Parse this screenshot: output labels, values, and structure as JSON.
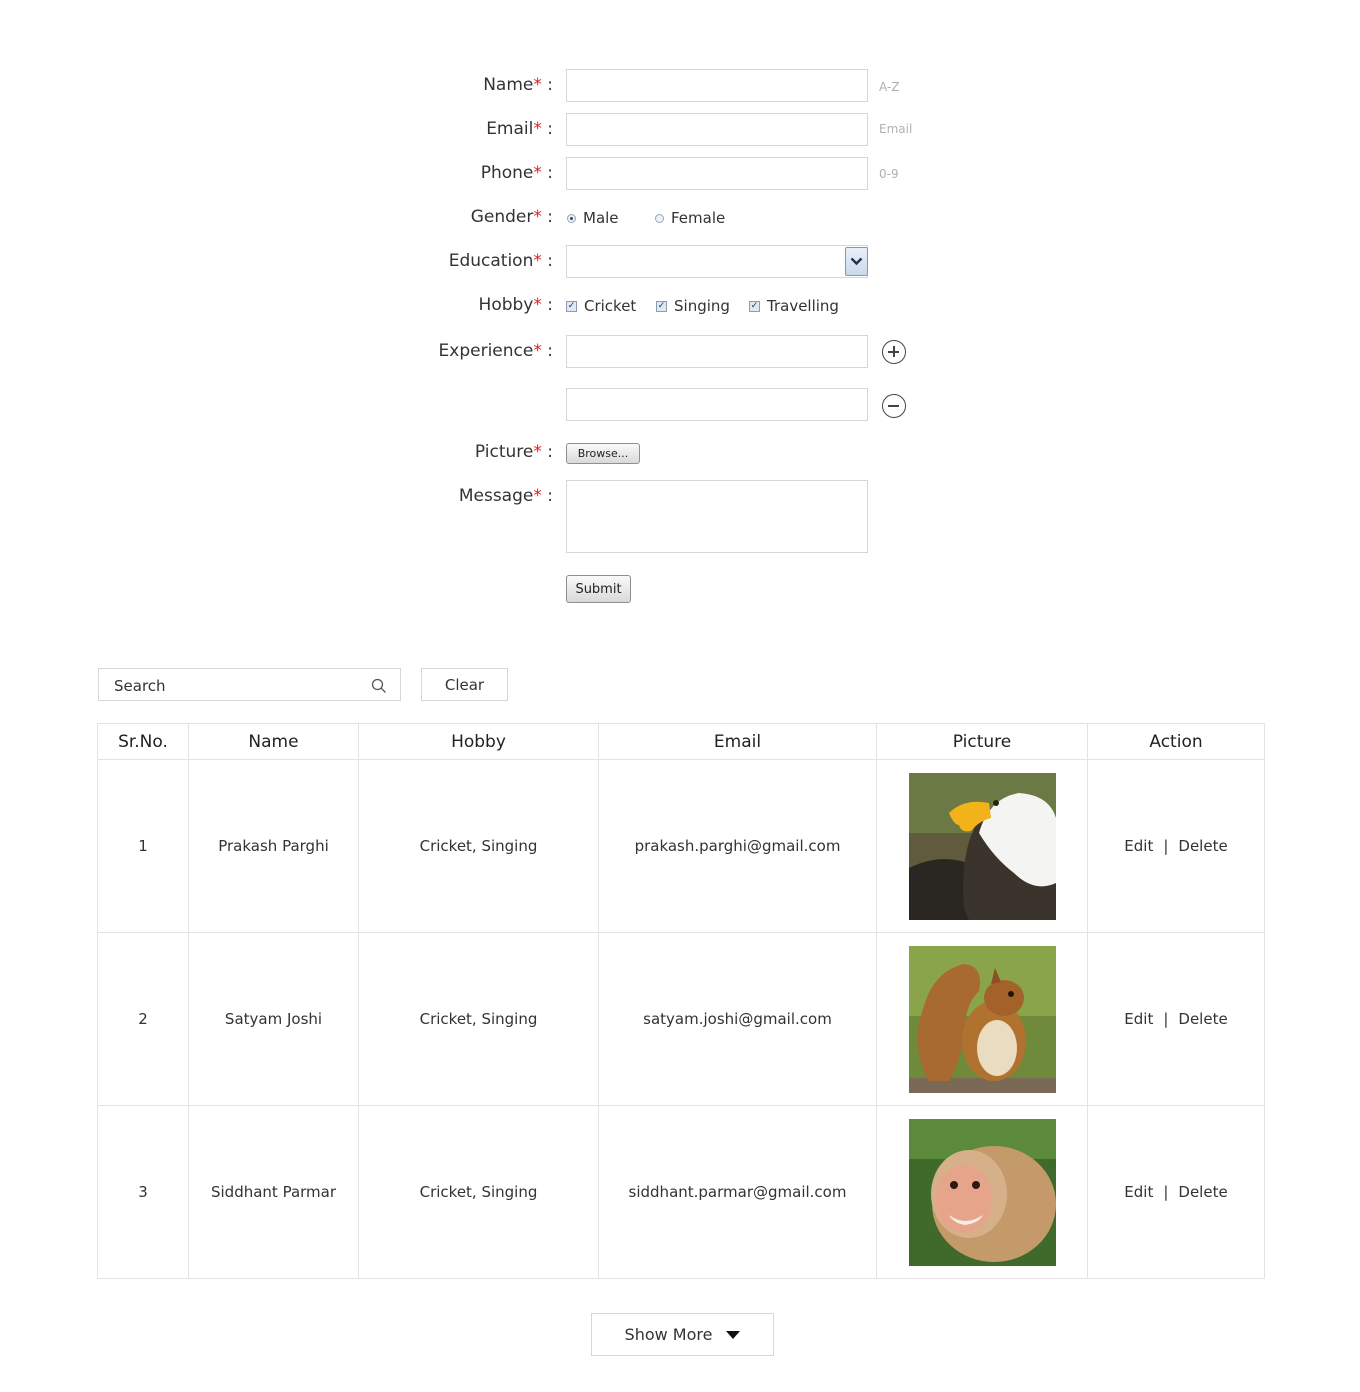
{
  "form": {
    "name": {
      "label": "Name",
      "required": "*",
      "hint": "A-Z"
    },
    "email": {
      "label": "Email",
      "required": "*",
      "hint": "Email"
    },
    "phone": {
      "label": "Phone",
      "required": "*",
      "hint": "0-9"
    },
    "gender": {
      "label": "Gender",
      "required": "*",
      "options": [
        "Male",
        "Female"
      ],
      "selected": "Male"
    },
    "education": {
      "label": "Education",
      "required": "*",
      "value": ""
    },
    "hobby": {
      "label": "Hobby",
      "required": "*",
      "options": [
        "Cricket",
        "Singing",
        "Travelling"
      ],
      "checked": [
        "Cricket",
        "Singing",
        "Travelling"
      ]
    },
    "experience": {
      "label": "Experience",
      "required": "*"
    },
    "picture": {
      "label": "Picture",
      "required": "*",
      "browse_label": "Browse..."
    },
    "message": {
      "label": "Message",
      "required": "*"
    },
    "submit_label": "Submit",
    "colon": ":"
  },
  "search": {
    "placeholder": "Search",
    "clear_label": "Clear"
  },
  "table": {
    "headers": [
      "Sr.No.",
      "Name",
      "Hobby",
      "Email",
      "Picture",
      "Action"
    ],
    "rows": [
      {
        "sr": "1",
        "name": "Prakash Parghi",
        "hobby": "Cricket, Singing",
        "email": "prakash.parghi@gmail.com",
        "picture": "eagle",
        "edit": "Edit",
        "sep": "|",
        "delete": "Delete"
      },
      {
        "sr": "2",
        "name": "Satyam Joshi",
        "hobby": "Cricket, Singing",
        "email": "satyam.joshi@gmail.com",
        "picture": "squirrel",
        "edit": "Edit",
        "sep": "|",
        "delete": "Delete"
      },
      {
        "sr": "3",
        "name": "Siddhant Parmar",
        "hobby": "Cricket, Singing",
        "email": "siddhant.parmar@gmail.com",
        "picture": "monkey",
        "edit": "Edit",
        "sep": "|",
        "delete": "Delete"
      }
    ]
  },
  "show_more_label": "Show More",
  "icons": {
    "search": "search-icon",
    "add": "plus-circle-icon",
    "remove": "minus-circle-icon",
    "dropdown": "chevron-down-icon",
    "caret": "caret-down-icon"
  },
  "colors": {
    "required": "#e02020",
    "border": "#d6d6d6",
    "hint": "#b0b0b0"
  }
}
